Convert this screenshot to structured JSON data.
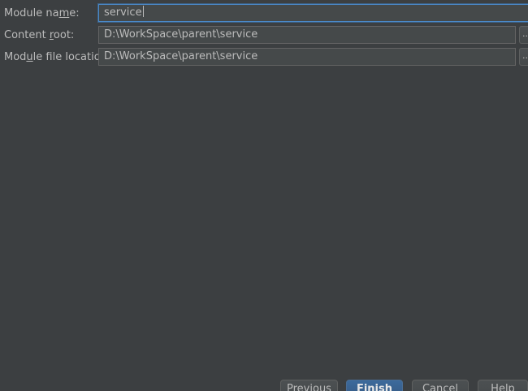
{
  "form": {
    "module_name": {
      "label_pre": "Module na",
      "label_mnemonic": "m",
      "label_post": "e:",
      "value": "service"
    },
    "content_root": {
      "label_pre": "Content ",
      "label_mnemonic": "r",
      "label_post": "oot:",
      "value": "D:\\WorkSpace\\parent\\service"
    },
    "module_file_location": {
      "label_pre": "Mod",
      "label_mnemonic": "u",
      "label_post": "le file location:",
      "value": "D:\\WorkSpace\\parent\\service"
    },
    "browse_label": "..."
  },
  "footer": {
    "previous_label": "Previous",
    "finish_label": "Finish",
    "cancel_label": "Cancel",
    "help_label": "Help"
  },
  "colors": {
    "background": "#3c3f41",
    "focus_border": "#4a88c7",
    "primary_button": "#365880"
  }
}
